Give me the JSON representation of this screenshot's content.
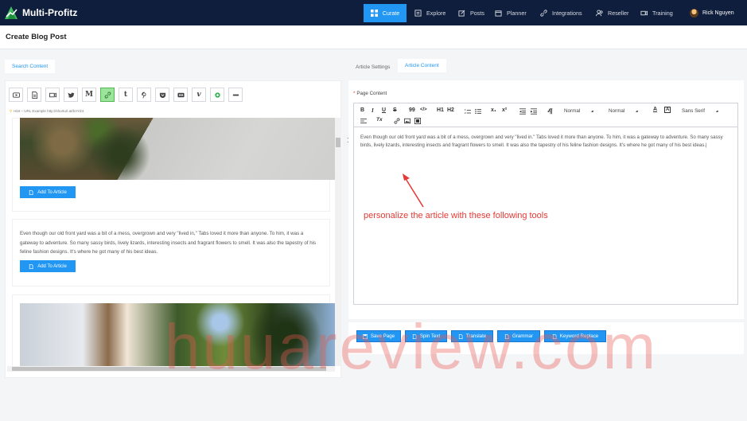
{
  "app": {
    "brand": "Multi-Profitz"
  },
  "nav": {
    "items": [
      {
        "label": "Curate",
        "icon": "grid-icon",
        "active": true
      },
      {
        "label": "Explore",
        "icon": "explore-icon"
      },
      {
        "label": "Posts",
        "icon": "edit-icon"
      },
      {
        "label": "Planner",
        "icon": "calendar-icon"
      },
      {
        "label": "Integrations",
        "icon": "link-icon"
      },
      {
        "label": "Reseller",
        "icon": "users-icon"
      },
      {
        "label": "Training",
        "icon": "video-icon"
      }
    ],
    "user_name": "Rick Nguyen"
  },
  "page": {
    "title": "Create Blog Post"
  },
  "left": {
    "tab_label": "Search Content",
    "sources": [
      "youtube-icon",
      "document-icon",
      "video-icon",
      "twitter-icon",
      "medium-icon",
      "link-icon",
      "tumblr-icon",
      "pinterest-icon",
      "pocket-icon",
      "flickr-icon",
      "vimeo-icon",
      "feedly-icon",
      "more-icon"
    ],
    "medium_glyph": "M",
    "tumblr_glyph": "t",
    "vimeo_glyph": "v",
    "hint": "Hint – URL Example http://shorturl.at/bAYZ4",
    "add_label": "Add To Article",
    "card_text": "Even though our old front yard was a bit of a mess, overgrown and very \"lived in,\" Tabs loved it more than anyone. To him, it was a gateway to adventure. So many sassy birds, lively lizards, interesting insects and fragrant flowers to smell. It was also the tapestry of his feline fashion designs. It's where he got many of his best ideas."
  },
  "right": {
    "tabs": {
      "settings": "Article Settings",
      "content": "Article Content"
    },
    "page_content_label": "Page Content",
    "required_mark": "*",
    "toolbar": {
      "bold": "B",
      "italic": "I",
      "underline": "U",
      "strike": "S",
      "quote": "99",
      "code": "</>",
      "h1": "H1",
      "h2": "H2",
      "sub": "x₁",
      "sup": "x²",
      "size_select": "Normal",
      "header_select": "Normal",
      "font_select": "Sans Serif",
      "clear": "Tx",
      "color": "A",
      "background": "A"
    },
    "editor_text": "Even though our old front yard was a bit of a mess, overgrown and very \"lived in.\" Tabs loved it more than anyone. To him, it was a gateway to adventure. So many sassy birds, lively lizards, interesting insects and fragrant flowers to smell. It was also the tapestry of his feline fashion designs. It's where he got many of his best ideas.|",
    "annotation": "personalize the article with these following tools",
    "actions": [
      "Save Page",
      "Spin Text",
      "Translate",
      "Grammar",
      "Keyword Replace"
    ]
  },
  "watermark": "huuareview.com",
  "colors": {
    "nav_bg": "#0f1e3c",
    "accent": "#2196f3",
    "annotation": "#e53935"
  }
}
